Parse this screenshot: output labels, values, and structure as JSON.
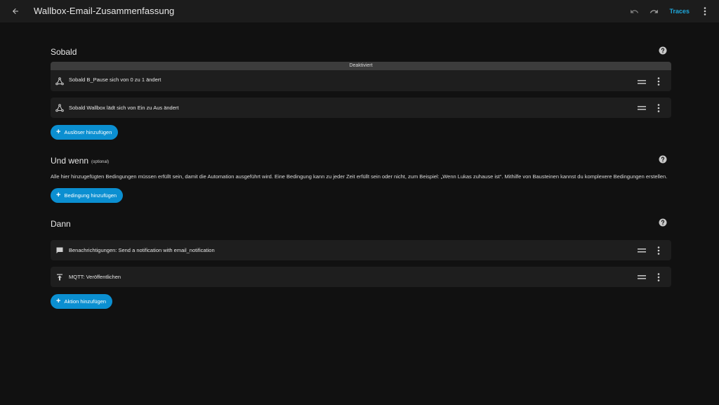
{
  "header": {
    "title": "Wallbox-Email-Zusammenfassung",
    "traces_label": "Traces",
    "back_icon": "arrow-left-icon",
    "undo_icon": "undo-icon",
    "redo_icon": "redo-icon",
    "menu_icon": "dots-vertical-icon"
  },
  "triggers": {
    "title": "Sobald",
    "items": [
      {
        "label": "Sobald B_Pause sich von 0 zu 1 ändert",
        "banner": "Deaktiviert",
        "icon": "state-trigger-icon"
      },
      {
        "label": "Sobald Wallbox lädt sich von Ein zu Aus ändert",
        "icon": "state-trigger-icon"
      }
    ],
    "add_label": "Auslöser hinzufügen"
  },
  "conditions": {
    "title": "Und wenn",
    "optional": "(optional)",
    "description": "Alle hier hinzugefügten Bedingungen müssen erfüllt sein, damit die Automation ausgeführt wird. Eine Bedingung kann zu jeder Zeit erfüllt sein oder nicht, zum Beispiel: „Wenn Lukas zuhause ist“. Mithilfe von Bausteinen kannst du komplexere Bedingungen erstellen.",
    "add_label": "Bedingung hinzufügen"
  },
  "actions": {
    "title": "Dann",
    "items": [
      {
        "label": "Benachrichtigungen: Send a notification with email_notification",
        "icon": "message-icon"
      },
      {
        "label": "MQTT: Veröffentlichen",
        "icon": "publish-icon"
      }
    ],
    "add_label": "Aktion hinzufügen"
  },
  "colors": {
    "background": "#111111",
    "card": "#1e1e1e",
    "accent": "#0b8fd1",
    "traces": "#1ea8dc"
  }
}
